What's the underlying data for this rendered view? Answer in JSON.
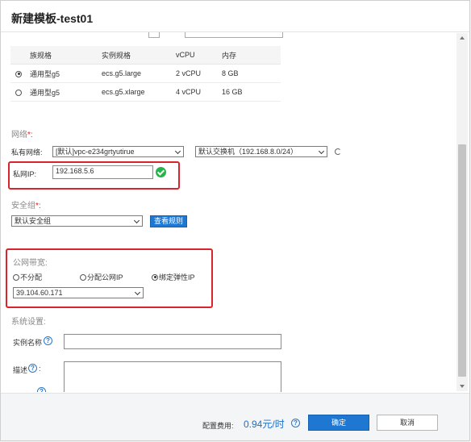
{
  "dialog": {
    "title": "新建模板-test01"
  },
  "spec_table": {
    "headers": [
      "族规格",
      "实例规格",
      "vCPU",
      "内存"
    ],
    "rows": [
      {
        "family": "通用型g5",
        "type": "ecs.g5.large",
        "vcpu": "2 vCPU",
        "memory": "8 GB",
        "selected": true
      },
      {
        "family": "通用型g5",
        "type": "ecs.g5.xlarge",
        "vcpu": "4 vCPU",
        "memory": "16 GB",
        "selected": false
      }
    ]
  },
  "network": {
    "section_label": "网络",
    "required_mark": "*:",
    "vpc_label": "私有网络:",
    "vpc_value": "[默认]vpc-e234grtyutirue",
    "switch_value": "默认交换机（192.168.8.0/24）",
    "private_ip_label": "私网IP:",
    "private_ip_value": "192.168.5.6"
  },
  "security_group": {
    "section_label": "安全组",
    "required_mark": "*:",
    "value": "默认安全组",
    "view_rules_label": "查看规则"
  },
  "bandwidth": {
    "section_label": "公网带宽:",
    "options": [
      {
        "label": "不分配",
        "selected": false
      },
      {
        "label": "分配公网IP",
        "selected": false
      },
      {
        "label": "绑定弹性IP",
        "selected": true
      }
    ],
    "eip_value": "39.104.60.171"
  },
  "system": {
    "section_label": "系统设置:",
    "instance_name_label": "实例名称",
    "description_label": "描述",
    "help_glyph": "?"
  },
  "footer": {
    "fee_label": "配置费用:",
    "fee_value": "0.94元/时",
    "confirm_label": "确定",
    "cancel_label": "取消"
  },
  "colors": {
    "accent": "#1e78d2",
    "highlight": "#d9232d",
    "success": "#27b24a",
    "required": "#d22222"
  }
}
